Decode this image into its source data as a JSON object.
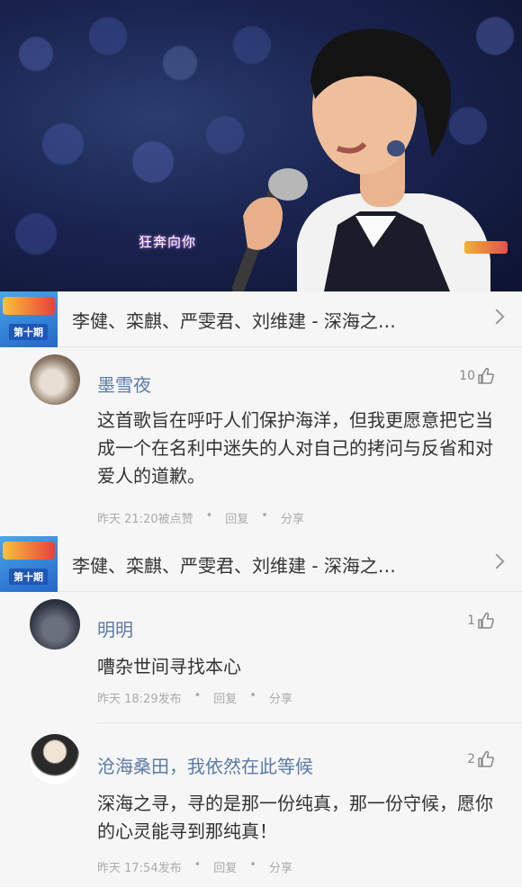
{
  "video": {
    "lyric": "狂奔向你"
  },
  "songs": [
    {
      "title": "李健、栾麒、严雯君、刘维建 - 深海之…",
      "thumb_label": "第十期"
    },
    {
      "title": "李健、栾麒、严雯君、刘维建 - 深海之…",
      "thumb_label": "第十期"
    }
  ],
  "comments": [
    {
      "user": "墨雪夜",
      "likes": "10",
      "text": "这首歌旨在呼吁人们保护海洋，但我更愿意把它当成一个在名利中迷失的人对自己的拷问与反省和对爱人的道歉。",
      "time": "昨天 21:20被点赞",
      "reply": "回复",
      "share": "分享"
    },
    {
      "user": "明明",
      "likes": "1",
      "text": "嘈杂世间寻找本心",
      "time": "昨天 18:29发布",
      "reply": "回复",
      "share": "分享"
    },
    {
      "user": "沧海桑田，我依然在此等候",
      "likes": "2",
      "text": "深海之寻，寻的是那一份纯真，那一份守候，愿你的心灵能寻到那纯真！",
      "time": "昨天 17:54发布",
      "reply": "回复",
      "share": "分享"
    }
  ],
  "colors": {
    "username": "#5b7aa8",
    "meta": "#aaaaaa",
    "background": "#f6f6f6"
  },
  "icons": [
    "thumbs-up-icon",
    "chevron-right-icon"
  ]
}
